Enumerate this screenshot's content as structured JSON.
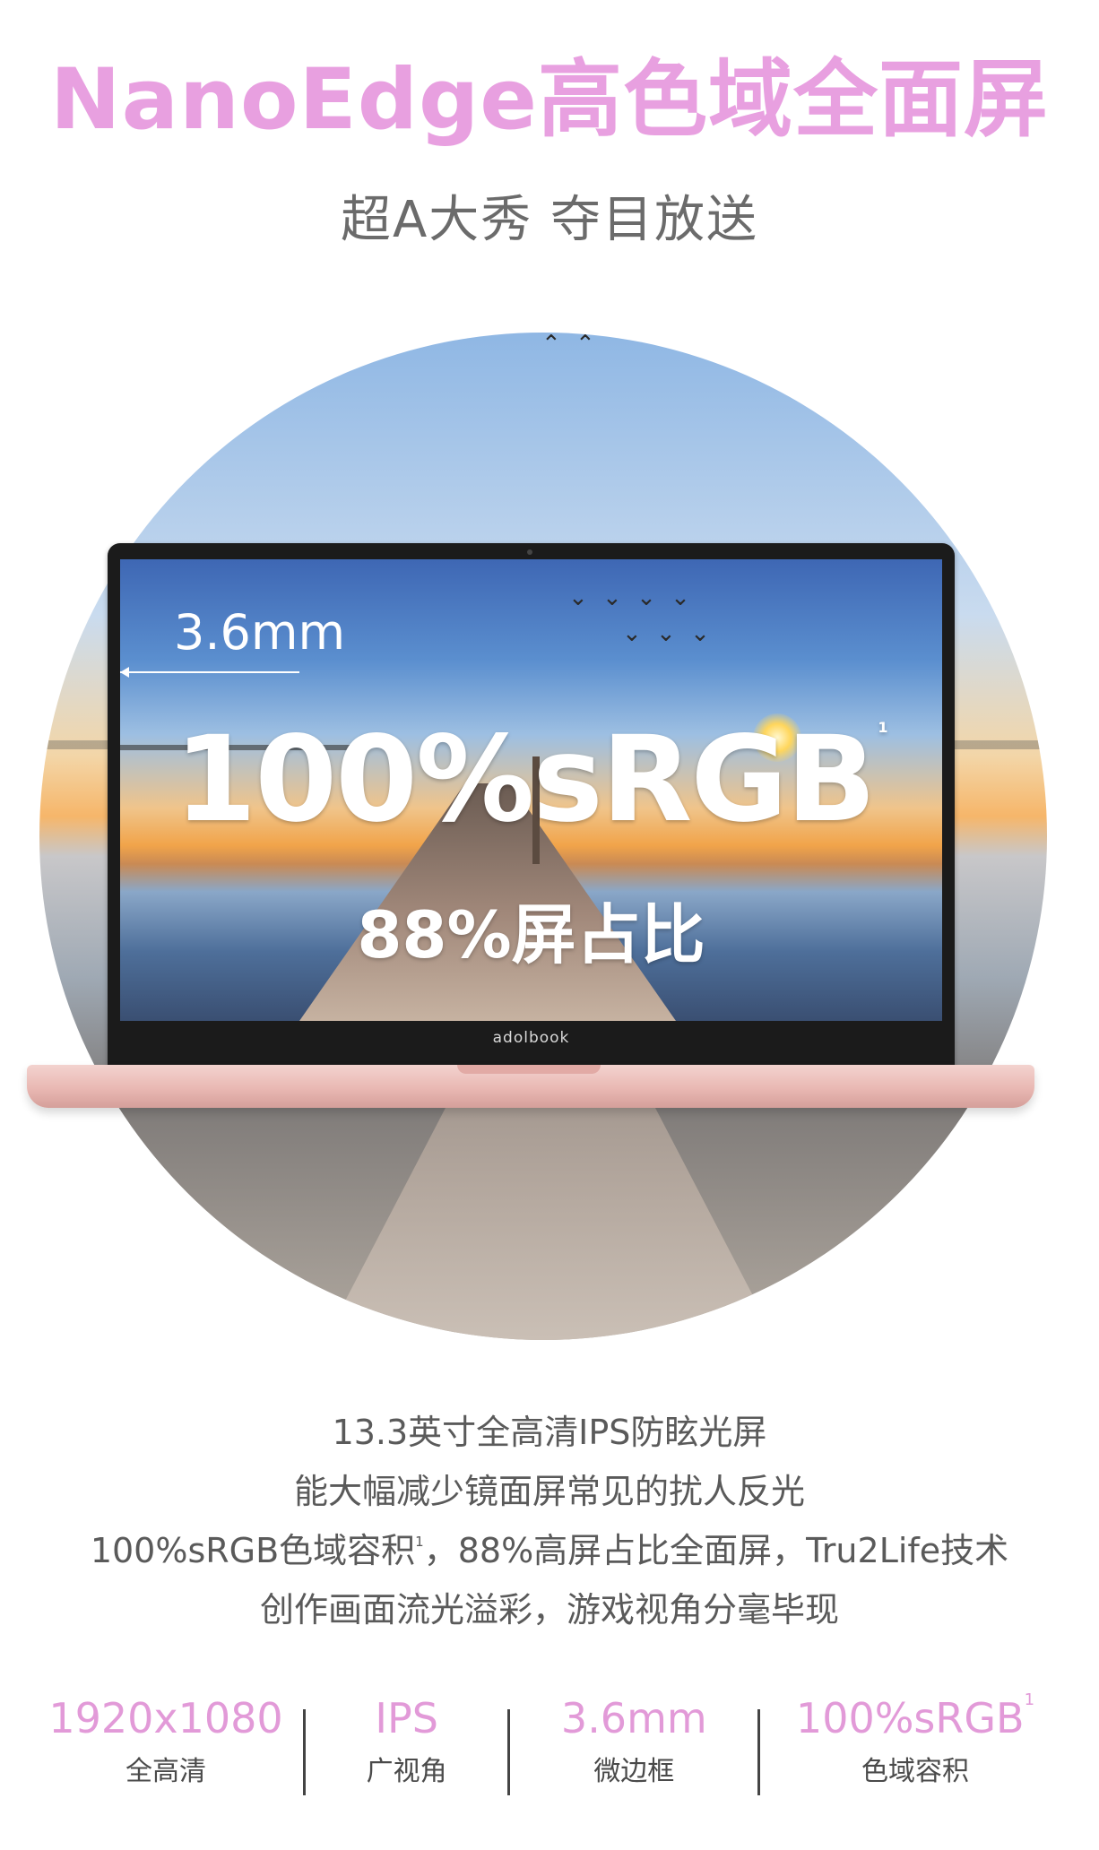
{
  "header": {
    "title": "NanoEdge高色域全面屏",
    "subtitle": "超A大秀  夺目放送"
  },
  "hero": {
    "bezel_label": "3.6mm",
    "main_text": "100%sRGB",
    "main_footnote": "1",
    "sub_text": "88%屏占比",
    "brand": "adolbook"
  },
  "description": {
    "line1": "13.3英寸全高清IPS防眩光屏",
    "line2": "能大幅减少镜面屏常见的扰人反光",
    "line3_a": "100%sRGB色域容积",
    "line3_sup": "1",
    "line3_b": "，88%高屏占比全面屏，Tru2Life技术",
    "line4": "创作画面流光溢彩，游戏视角分毫毕现"
  },
  "specs": [
    {
      "value": "1920x1080",
      "label": "全高清"
    },
    {
      "value": "IPS",
      "label": "广视角"
    },
    {
      "value": "3.6mm",
      "label": "微边框"
    },
    {
      "value": "100%sRGB",
      "sup": "1",
      "label": "色域容积"
    }
  ],
  "colors": {
    "accent": "#e29ad8",
    "headline": "#e8a0e0",
    "laptop_base": "#e9b8b3"
  }
}
